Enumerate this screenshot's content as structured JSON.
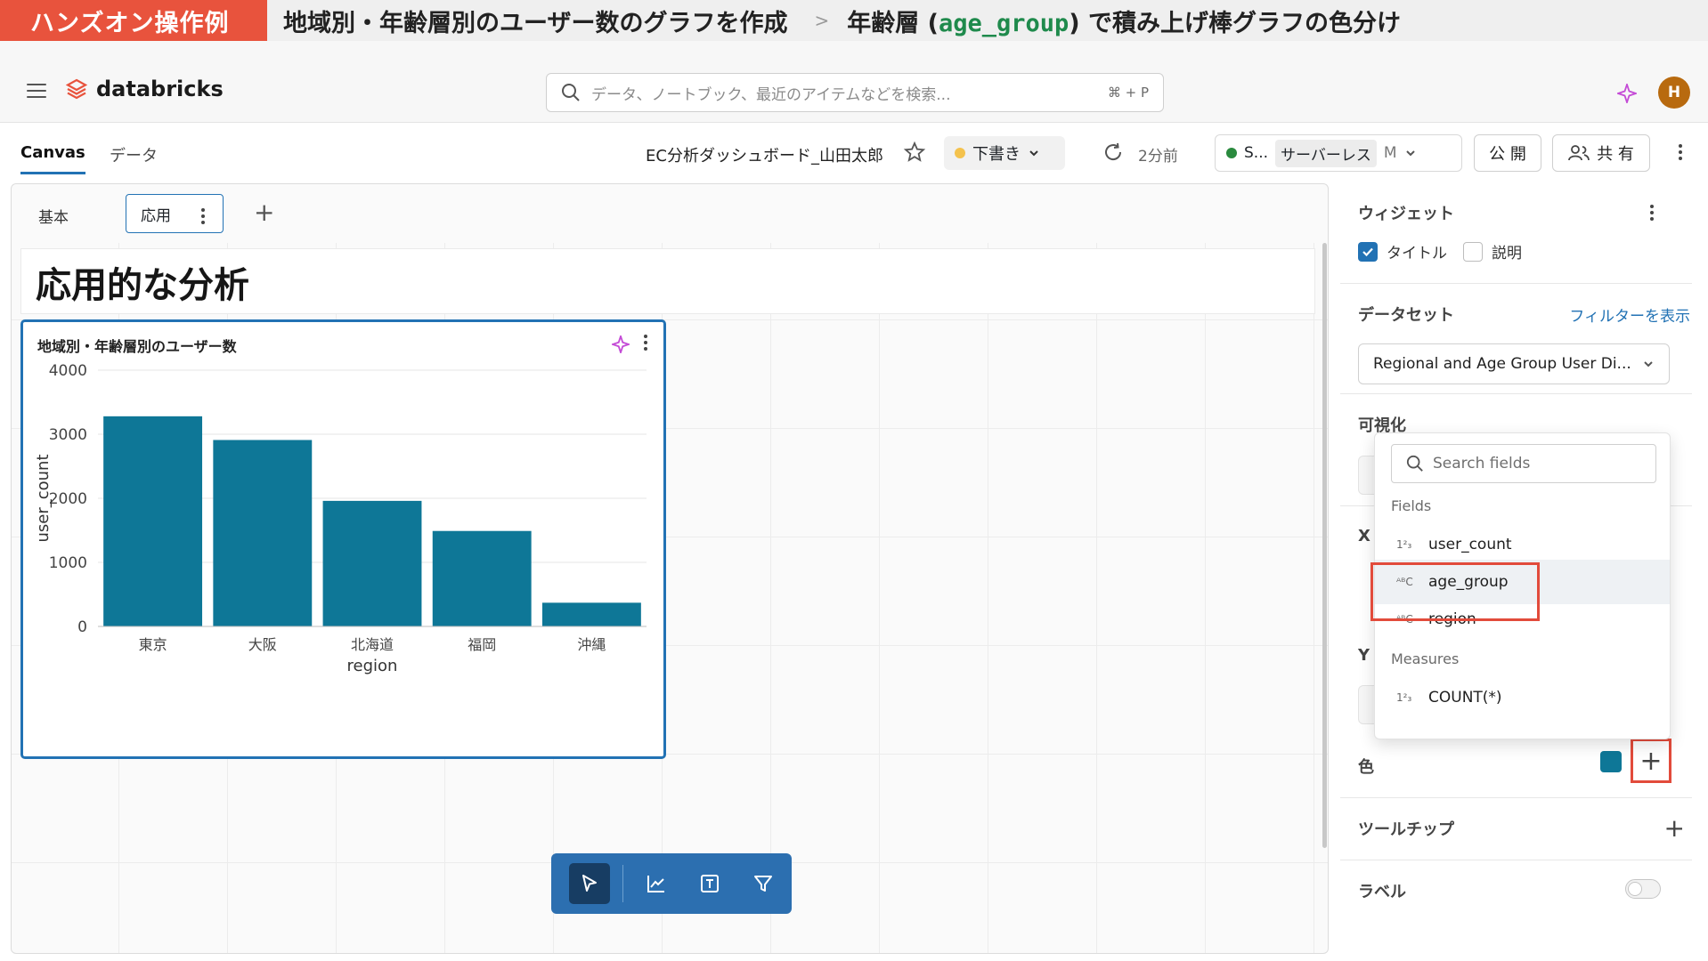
{
  "banner": {
    "tag": "ハンズオン操作例",
    "title": "地域別・年齢層別のユーザー数のグラフを作成",
    "separator": ">",
    "step_prefix": "年齢層 (",
    "step_code": "age_group",
    "step_suffix": ") で積み上げ棒グラフの色分け"
  },
  "header": {
    "logo_text": "databricks",
    "search_placeholder": "データ、ノートブック、最近のアイテムなどを検索...",
    "search_shortcut": "⌘ + P",
    "avatar_initial": "H"
  },
  "toolbar": {
    "tabs": [
      {
        "label": "Canvas",
        "active": true
      },
      {
        "label": "データ",
        "active": false
      }
    ],
    "dashboard_title": "EC分析ダッシュボード_山田太郎",
    "draft_label": "下書き",
    "last_refreshed": "2分前",
    "warehouse_status": "S...",
    "warehouse_type": "サーバーレス",
    "warehouse_size": "M",
    "publish_label": "公 開",
    "share_label": "共 有"
  },
  "canvas": {
    "page_tabs": [
      {
        "label": "基本",
        "active": false
      },
      {
        "label": "応用",
        "active": true
      }
    ],
    "heading": "応用的な分析"
  },
  "widget": {
    "title": "地域別・年齢層別のユーザー数"
  },
  "chart_data": {
    "type": "bar",
    "title": "地域別・年齢層別のユーザー数",
    "xlabel": "region",
    "ylabel": "user_count",
    "categories": [
      "東京",
      "大阪",
      "北海道",
      "福岡",
      "沖縄"
    ],
    "values": [
      3280,
      2910,
      1960,
      1490,
      370
    ],
    "ylim": [
      0,
      4000
    ],
    "yticks": [
      0,
      1000,
      2000,
      3000,
      4000
    ],
    "bar_color": "#0e7797",
    "grid": true
  },
  "panel": {
    "widget_label": "ウィジェット",
    "title_checkbox": "タイトル",
    "title_checked": true,
    "desc_checkbox": "説明",
    "desc_checked": false,
    "dataset_label": "データセット",
    "show_filters": "フィルターを表示",
    "dataset_value": "Regional and Age Group User Di...",
    "viz_label": "可視化",
    "x_label_partial": "X",
    "y_label_partial": "Y",
    "color_label": "色",
    "color_value": "#0e7797",
    "tooltip_label": "ツールチップ",
    "label_label": "ラベル"
  },
  "field_picker": {
    "search_placeholder": "Search fields",
    "fields_header": "Fields",
    "fields": [
      {
        "name": "user_count",
        "type": "numeric"
      },
      {
        "name": "age_group",
        "type": "string"
      },
      {
        "name": "region",
        "type": "string"
      }
    ],
    "measures_header": "Measures",
    "measures": [
      {
        "name": "COUNT(*)",
        "type": "numeric"
      }
    ]
  }
}
